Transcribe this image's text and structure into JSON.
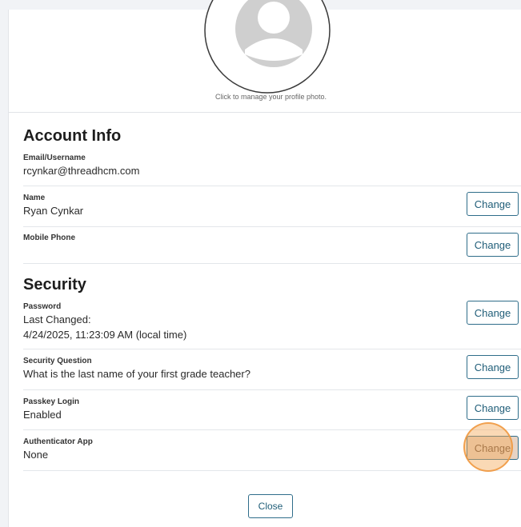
{
  "profile_photo": {
    "caption": "Click to manage your profile photo."
  },
  "account_info": {
    "title": "Account Info",
    "rows": [
      {
        "label": "Email/Username",
        "value": "rcynkar@threadhcm.com",
        "button": ""
      },
      {
        "label": "Name",
        "value": "Ryan Cynkar",
        "button": "Change"
      },
      {
        "label": "Mobile Phone",
        "value": "",
        "button": "Change"
      }
    ]
  },
  "security": {
    "title": "Security",
    "rows": [
      {
        "label": "Password",
        "value_line1": "Last Changed:",
        "value_line2": "4/24/2025, 11:23:09 AM (local time)",
        "button": "Change"
      },
      {
        "label": "Security Question",
        "value": "What is the last name of your first grade teacher?",
        "button": "Change"
      },
      {
        "label": "Passkey Login",
        "value": "Enabled",
        "button": "Change"
      },
      {
        "label": "Authenticator App",
        "value": "None",
        "button": "Change"
      }
    ]
  },
  "footer": {
    "close_label": "Close"
  },
  "colors": {
    "button_border": "#2f6d8a",
    "button_text": "#1f5d78",
    "highlight_ring": "#f0963c"
  }
}
